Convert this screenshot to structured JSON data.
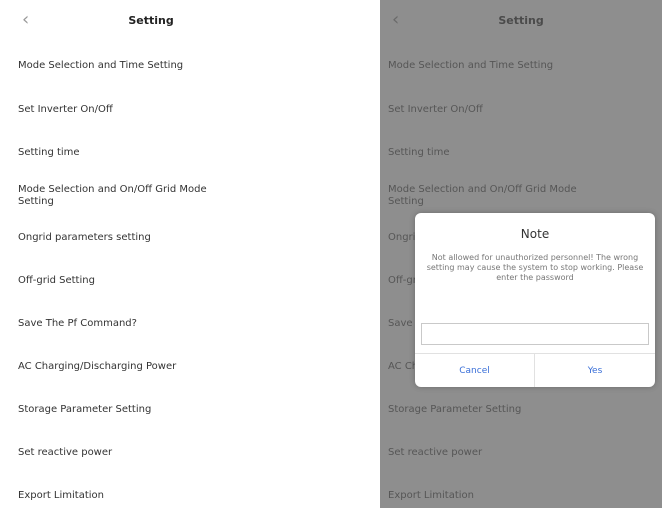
{
  "header": {
    "back_glyph": "‹",
    "title": "Setting"
  },
  "items": [
    {
      "label": "Mode Selection and Time Setting"
    },
    {
      "label": "Set Inverter On/Off"
    },
    {
      "label": "Setting time"
    },
    {
      "label": "Mode Selection and On/Off Grid Mode Setting"
    },
    {
      "label": "Ongrid parameters setting"
    },
    {
      "label": "Off-grid Setting"
    },
    {
      "label": "Save The Pf Command?"
    },
    {
      "label": "AC Charging/Discharging Power"
    },
    {
      "label": "Storage Parameter Setting"
    },
    {
      "label": "Set reactive power"
    },
    {
      "label": "Export Limitation"
    }
  ],
  "chevron_glyph": "›",
  "dialog": {
    "title": "Note",
    "message": "Not allowed for unauthorized personnel! The wrong setting may cause the system to stop working. Please enter the password",
    "password_value": "",
    "cancel_label": "Cancel",
    "yes_label": "Yes"
  },
  "colors": {
    "accent": "#3a6fd8",
    "overlay": "#8e8e8e"
  },
  "icons": {
    "back": "back-chevron-icon",
    "row": "chevron-right-icon"
  }
}
